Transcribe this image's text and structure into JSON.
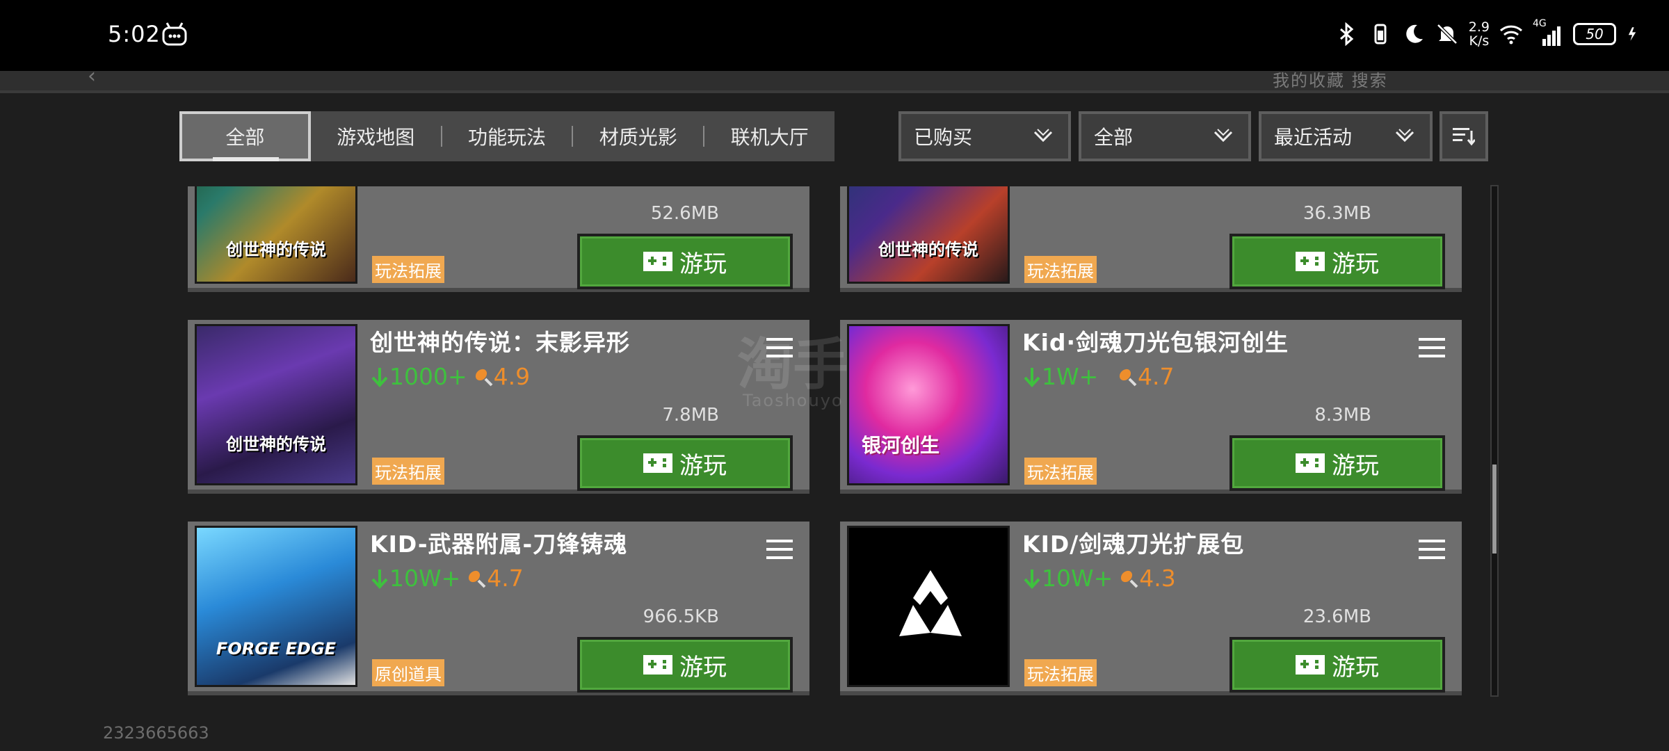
{
  "status_bar": {
    "time": "5:02",
    "net_speed_value": "2.9",
    "net_speed_unit": "K/s",
    "network": "4G",
    "battery": "50"
  },
  "header": {
    "faded_text": "我的收藏   搜索"
  },
  "tabs": [
    "全部",
    "游戏地图",
    "功能玩法",
    "材质光影",
    "联机大厅"
  ],
  "filters": {
    "purchase": "已购买",
    "type": "全部",
    "sort": "最近活动"
  },
  "cards": [
    {
      "name": "",
      "downloads": "",
      "rating": "",
      "size": "52.6MB",
      "tag": "玩法拓展",
      "play_label": "游玩",
      "thumb_text": "创世神的传说"
    },
    {
      "name": "",
      "downloads": "",
      "rating": "",
      "size": "36.3MB",
      "tag": "玩法拓展",
      "play_label": "游玩",
      "thumb_text": "创世神的传说"
    },
    {
      "name": "创世神的传说：末影异形",
      "downloads": "1000+",
      "rating": "4.9",
      "size": "7.8MB",
      "tag": "玩法拓展",
      "play_label": "游玩",
      "thumb_text": "创世神的传说"
    },
    {
      "name": "Kid·剑魂刀光包银河创生",
      "downloads": "1W+",
      "rating": "4.7",
      "size": "8.3MB",
      "tag": "玩法拓展",
      "play_label": "游玩",
      "thumb_text": "银河创生"
    },
    {
      "name": "KID-武器附属-刀锋铸魂",
      "downloads": "10W+",
      "rating": "4.7",
      "size": "966.5KB",
      "tag": "原创道具",
      "play_label": "游玩",
      "thumb_text": "FORGE EDGE"
    },
    {
      "name": "KID/剑魂刀光扩展包",
      "downloads": "10W+",
      "rating": "4.3",
      "size": "23.6MB",
      "tag": "玩法拓展",
      "play_label": "游玩",
      "thumb_text": ""
    }
  ],
  "watermark": {
    "line1": "淘手",
    "line2": "Taoshouyo"
  },
  "footer_id": "2323665663",
  "colors": {
    "play_green": "#3c8c2c",
    "download_green": "#3ec13e",
    "rating_orange": "#ee8e2c",
    "tag_orange": "#f0a850"
  },
  "icons": [
    "robot-icon",
    "bluetooth-icon",
    "vibrate-icon",
    "moon-icon",
    "mute-bell-icon",
    "wifi-icon",
    "signal-icon",
    "charging-icon",
    "chevron-down-icon",
    "sort-icon",
    "menu-icon",
    "gamepad-icon",
    "download-arrow-icon",
    "drumstick-icon"
  ]
}
